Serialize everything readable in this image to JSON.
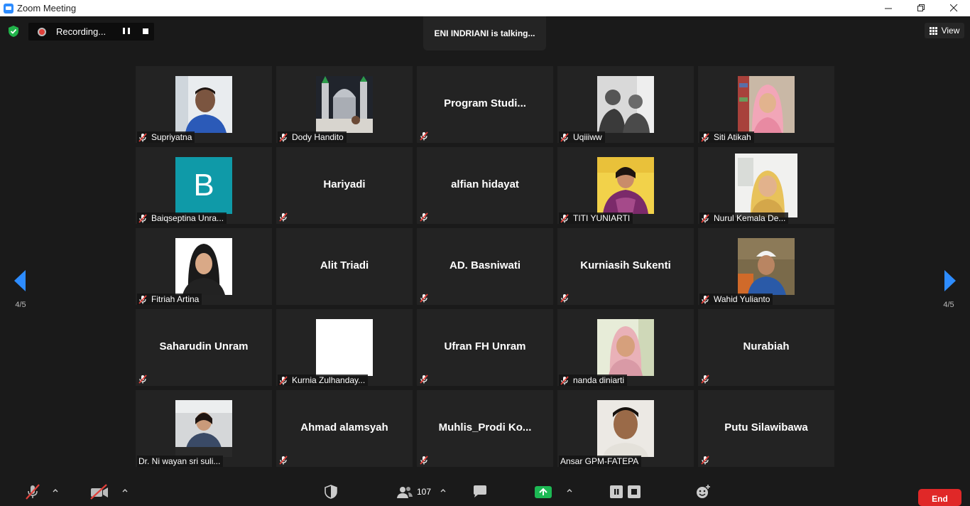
{
  "window": {
    "title": "Zoom Meeting"
  },
  "status": {
    "recording_label": "Recording...",
    "talking_label": "ENI INDRIANI is talking...",
    "view_label": "View"
  },
  "pagination": {
    "left": "4/5",
    "right": "4/5"
  },
  "participants": [
    {
      "name": "Supriyatna"
    },
    {
      "name": "Dody Handito"
    },
    {
      "name": "Program  Studi..."
    },
    {
      "name": "Uqiiiww"
    },
    {
      "name": "Siti Atikah"
    },
    {
      "name": "Baiqseptina Unra...",
      "avatar_letter": "B"
    },
    {
      "name": "Hariyadi"
    },
    {
      "name": "alfian hidayat"
    },
    {
      "name": "TITI YUNIARTI"
    },
    {
      "name": "Nurul Kemala De..."
    },
    {
      "name": "Fitriah Artina"
    },
    {
      "name": "Alit Triadi"
    },
    {
      "name": "AD. Basniwati"
    },
    {
      "name": "Kurniasih Sukenti"
    },
    {
      "name": "Wahid Yulianto"
    },
    {
      "name": "Saharudin Unram"
    },
    {
      "name": "Kurnia Zulhanday..."
    },
    {
      "name": "Ufran FH Unram"
    },
    {
      "name": "nanda diniarti"
    },
    {
      "name": "Nurabiah"
    },
    {
      "name": "Dr. Ni wayan sri suli..."
    },
    {
      "name": "Ahmad alamsyah"
    },
    {
      "name": "Muhlis_Prodi  Ko..."
    },
    {
      "name": "Ansar GPM-FATEPA"
    },
    {
      "name": "Putu Silawibawa"
    }
  ],
  "toolbar": {
    "participants_count": "107",
    "end_label": "End"
  },
  "colors": {
    "accent": "#2d8cff",
    "end": "#e02828",
    "muted": "#e0403a",
    "share": "#1db954"
  }
}
